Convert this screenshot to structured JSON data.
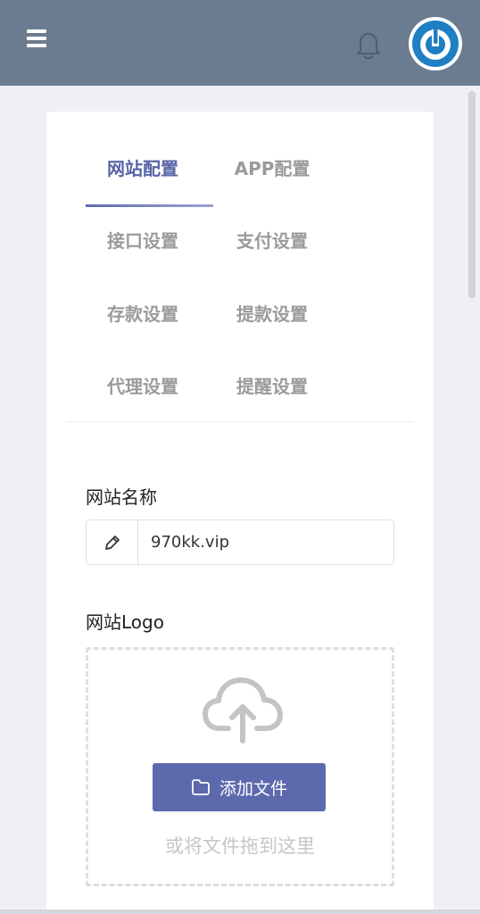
{
  "header": {
    "menu_icon": "hamburger-menu-icon",
    "notification_icon": "bell-icon",
    "power_icon": "power-icon",
    "power_color": "#1e7fc3",
    "background": "#6b7c90"
  },
  "tabs": [
    {
      "label": "网站配置",
      "active": true
    },
    {
      "label": "APP配置",
      "active": false
    },
    {
      "label": "接口设置",
      "active": false
    },
    {
      "label": "支付设置",
      "active": false
    },
    {
      "label": "存款设置",
      "active": false
    },
    {
      "label": "提款设置",
      "active": false
    },
    {
      "label": "代理设置",
      "active": false
    },
    {
      "label": "提醒设置",
      "active": false
    }
  ],
  "form": {
    "site_name": {
      "label": "网站名称",
      "value": "970kk.vip",
      "icon": "pencil-icon"
    },
    "site_logo": {
      "label": "网站Logo",
      "upload_icon": "cloud-upload-icon",
      "button_icon": "folder-icon",
      "button_label": "添加文件",
      "hint": "或将文件拖到这里"
    }
  },
  "colors": {
    "accent": "#5c69ad",
    "inactive_tab": "#9a9a9a"
  }
}
